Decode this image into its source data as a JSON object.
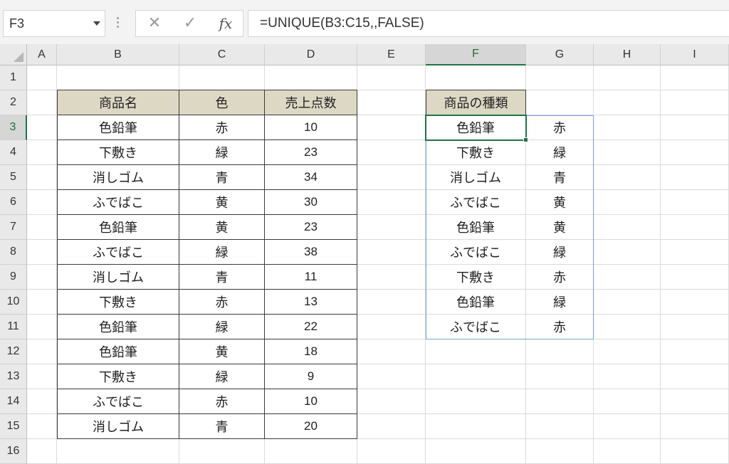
{
  "name_box": {
    "value": "F3"
  },
  "formula_bar": {
    "cancel_glyph": "✕",
    "enter_glyph": "✓",
    "fx_label": "fx",
    "formula": "=UNIQUE(B3:C15,,FALSE)"
  },
  "columns": [
    "A",
    "B",
    "C",
    "D",
    "E",
    "F",
    "G",
    "H",
    "I"
  ],
  "rows": [
    "1",
    "2",
    "3",
    "4",
    "5",
    "6",
    "7",
    "8",
    "9",
    "10",
    "11",
    "12",
    "13",
    "14",
    "15",
    "16"
  ],
  "selected_cell": {
    "column": "F",
    "row": "3"
  },
  "source_table": {
    "headers": [
      "商品名",
      "色",
      "売上点数"
    ],
    "rows": [
      [
        "色鉛筆",
        "赤",
        "10"
      ],
      [
        "下敷き",
        "緑",
        "23"
      ],
      [
        "消しゴム",
        "青",
        "34"
      ],
      [
        "ふでばこ",
        "黄",
        "30"
      ],
      [
        "色鉛筆",
        "黄",
        "23"
      ],
      [
        "ふでばこ",
        "緑",
        "38"
      ],
      [
        "消しゴム",
        "青",
        "11"
      ],
      [
        "下敷き",
        "赤",
        "13"
      ],
      [
        "色鉛筆",
        "緑",
        "22"
      ],
      [
        "色鉛筆",
        "黄",
        "18"
      ],
      [
        "下敷き",
        "緑",
        "9"
      ],
      [
        "ふでばこ",
        "赤",
        "10"
      ],
      [
        "消しゴム",
        "青",
        "20"
      ]
    ]
  },
  "result_table": {
    "header": "商品の種類",
    "rows": [
      [
        "色鉛筆",
        "赤"
      ],
      [
        "下敷き",
        "緑"
      ],
      [
        "消しゴム",
        "青"
      ],
      [
        "ふでばこ",
        "黄"
      ],
      [
        "色鉛筆",
        "黄"
      ],
      [
        "ふでばこ",
        "緑"
      ],
      [
        "下敷き",
        "赤"
      ],
      [
        "色鉛筆",
        "緑"
      ],
      [
        "ふでばこ",
        "赤"
      ]
    ]
  },
  "colors": {
    "header_fill": "#ddd8c4",
    "selection_green": "#217346",
    "spill_border": "#7aa3d6"
  }
}
